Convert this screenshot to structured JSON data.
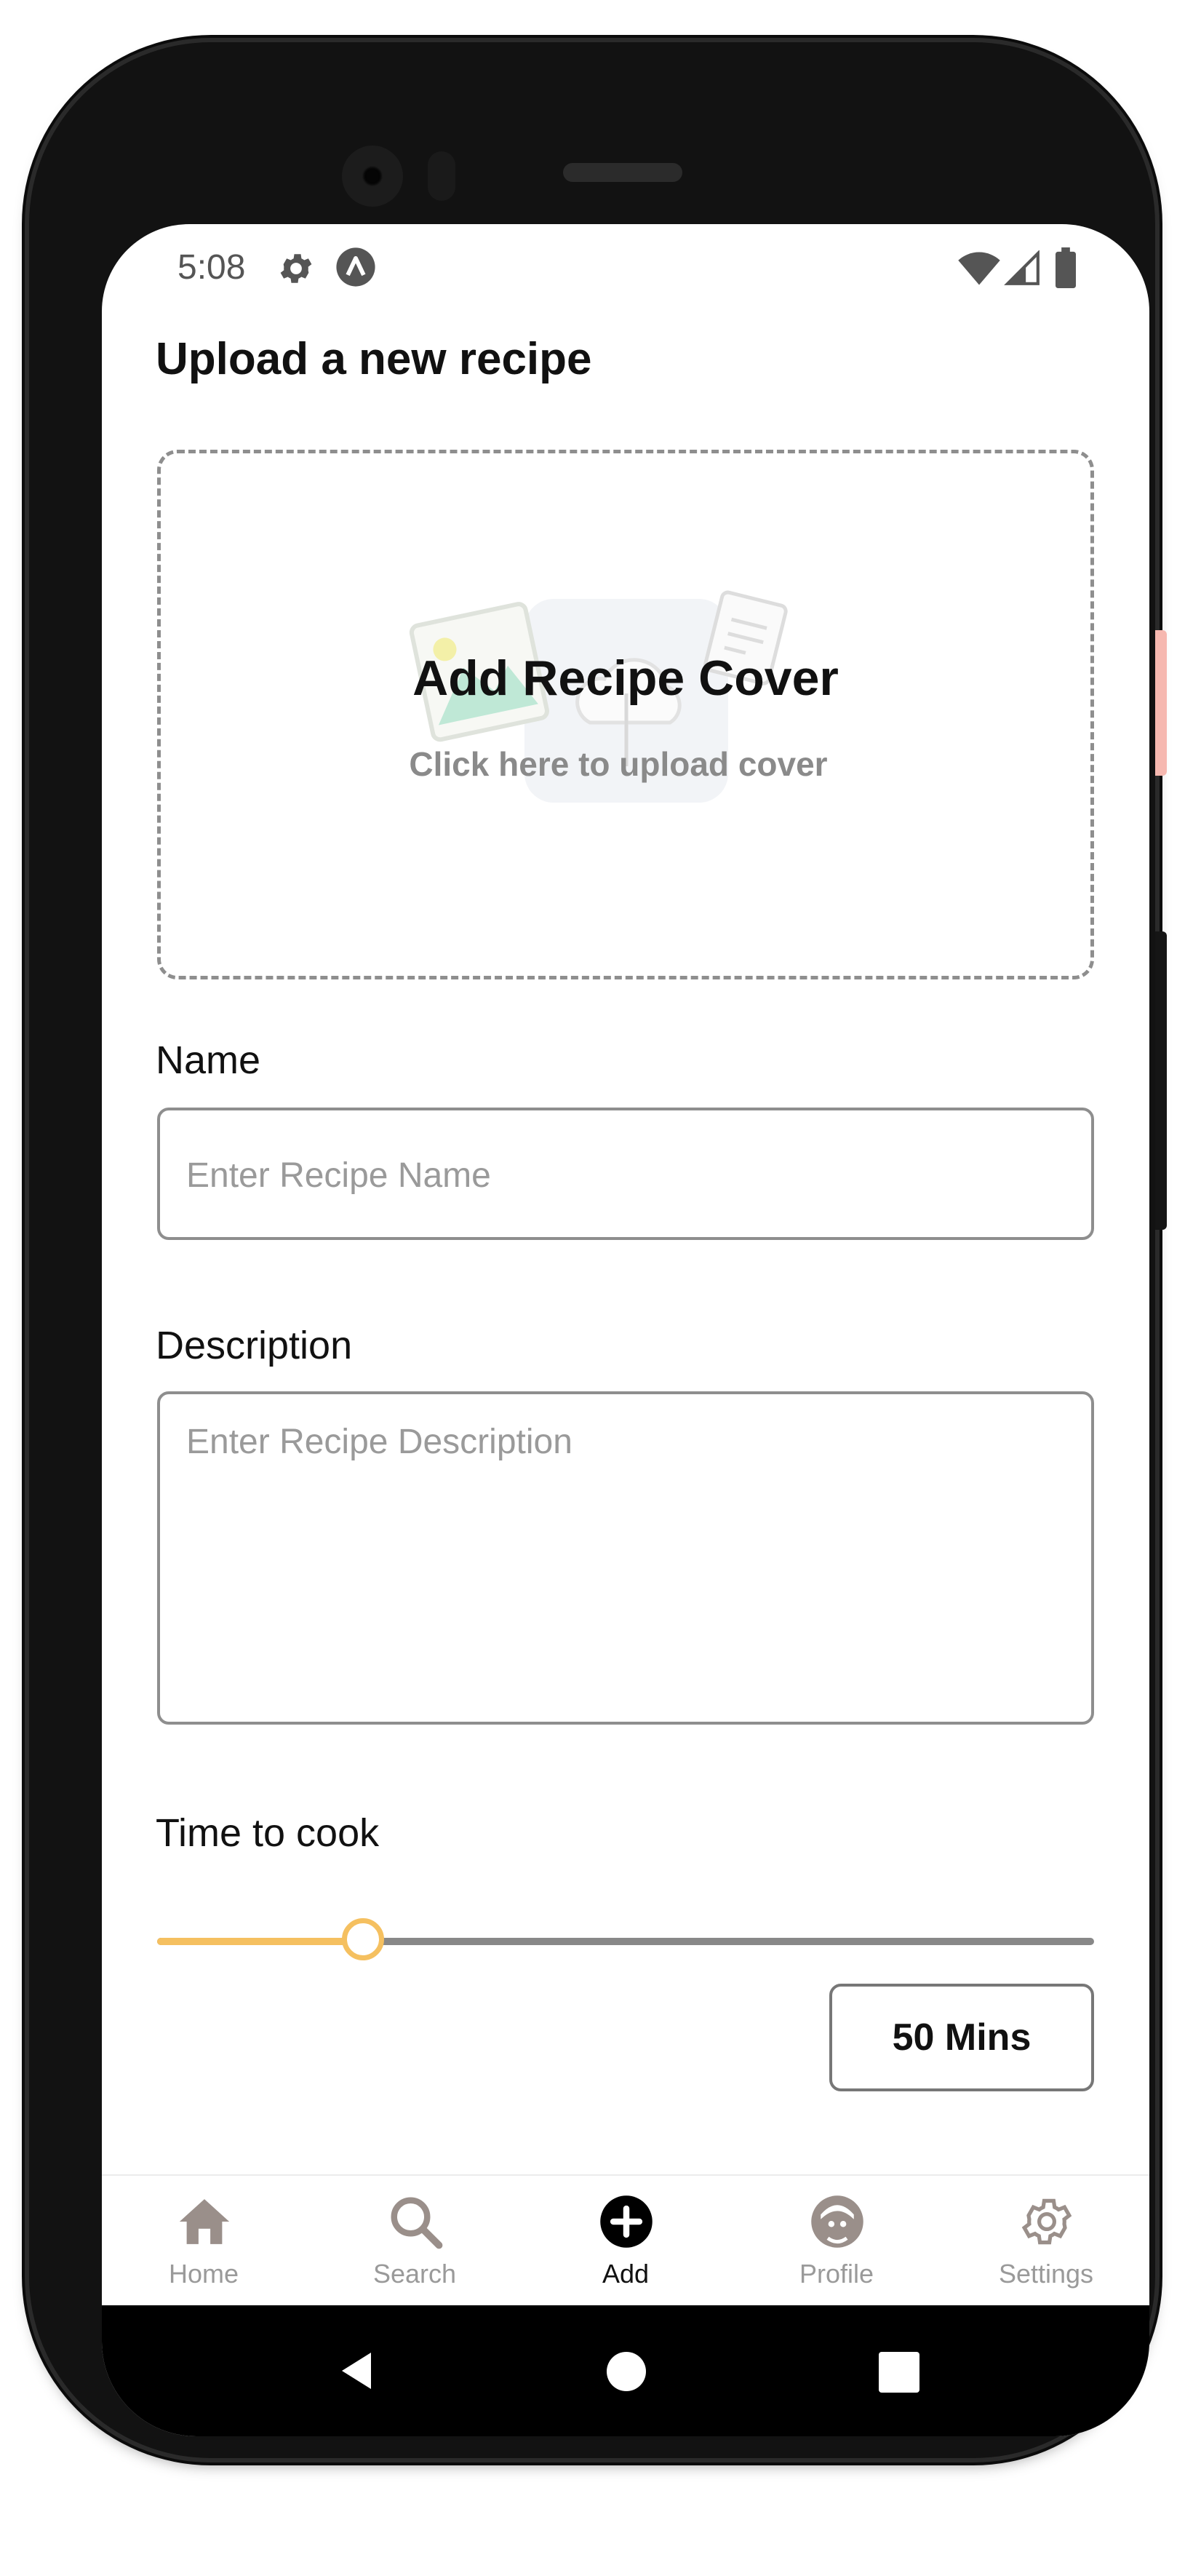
{
  "status_bar": {
    "time": "5:08"
  },
  "page": {
    "title": "Upload a new recipe"
  },
  "cover": {
    "title": "Add Recipe Cover",
    "subtitle": "Click here to upload cover"
  },
  "form": {
    "name_label": "Name",
    "name_placeholder": "Enter Recipe Name",
    "description_label": "Description",
    "description_placeholder": "Enter Recipe Description",
    "time_label": "Time to cook",
    "time_value": "50 Mins",
    "slider_fraction": 0.22
  },
  "colors": {
    "accent": "#f5c060",
    "track": "#888888",
    "border": "#8e8e8e"
  },
  "tabbar": {
    "items": [
      {
        "label": "Home",
        "icon": "home-icon"
      },
      {
        "label": "Search",
        "icon": "search-icon"
      },
      {
        "label": "Add",
        "icon": "add-icon",
        "active": true
      },
      {
        "label": "Profile",
        "icon": "profile-icon"
      },
      {
        "label": "Settings",
        "icon": "settings-icon"
      }
    ]
  }
}
